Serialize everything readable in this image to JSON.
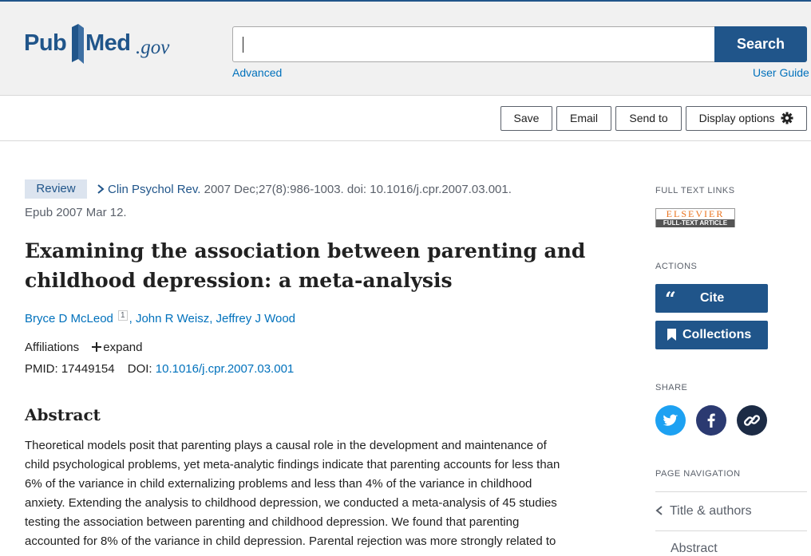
{
  "header": {
    "logo_pub": "Pub",
    "logo_med": "Med",
    "logo_gov": ".gov",
    "search_button": "Search",
    "search_value": "",
    "advanced_link": "Advanced",
    "user_guide_link": "User Guide"
  },
  "toolbar": {
    "save": "Save",
    "email": "Email",
    "send_to": "Send to",
    "display_options": "Display options"
  },
  "article": {
    "badge": "Review",
    "journal": "Clin Psychol Rev.",
    "citation": " 2007 Dec;27(8):986-1003. doi: 10.1016/j.cpr.2007.03.001.",
    "epub": "Epub 2007 Mar 12.",
    "title": "Examining the association between parenting and childhood depression: a meta-analysis",
    "author1": "Bryce D McLeod",
    "author1_sup": "1",
    "authors_rest": ", John R Weisz, Jeffrey J Wood",
    "affiliations_label": "Affiliations",
    "expand_label": "expand",
    "pmid_label": "PMID: 17449154",
    "doi_label": "DOI: ",
    "doi_value": "10.1016/j.cpr.2007.03.001",
    "abstract_heading": "Abstract",
    "abstract_lines": [
      "Theoretical models posit that parenting plays a causal role in the development and maintenance of",
      "child psychological problems, yet meta-analytic findings indicate that parenting accounts for less than",
      "6% of the variance in child externalizing problems and less than 4% of the variance in childhood",
      "anxiety. Extending the analysis to childhood depression, we conducted a meta-analysis of 45 studies",
      "testing the association between parenting and childhood depression. We found that parenting",
      "accounted for 8% of the variance in child depression. Parental rejection was more strongly related to"
    ]
  },
  "sidebar": {
    "full_text_heading": "FULL TEXT LINKS",
    "elsevier_top": "ELSEVIER",
    "elsevier_bottom": "FULL-TEXT ARTICLE",
    "actions_heading": "ACTIONS",
    "cite_button": "Cite",
    "collections_button": "Collections",
    "share_heading": "SHARE",
    "page_nav_heading": "PAGE NAVIGATION",
    "nav_title_authors": "Title & authors",
    "nav_next": "Abstract"
  },
  "colors": {
    "brand": "#20558a",
    "link": "#0071bc",
    "twitter": "#1da1f2",
    "facebook": "#2b3a71",
    "link_share": "#1c2b45"
  }
}
